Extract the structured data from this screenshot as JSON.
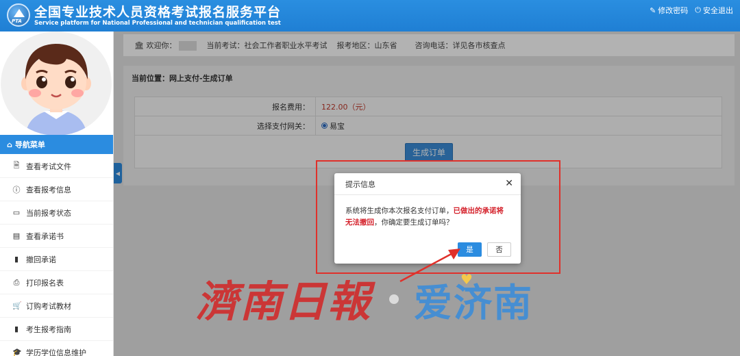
{
  "header": {
    "title_cn": "全国专业技术人员资格考试报名服务平台",
    "title_en": "Service platform for National Professional and technician qualification test",
    "logo_text": "PTA",
    "links": [
      {
        "icon": "edit-icon",
        "label": "修改密码"
      },
      {
        "icon": "power-icon",
        "label": "安全退出"
      }
    ]
  },
  "sidebar": {
    "nav_title": "导航菜单",
    "items": [
      {
        "icon": "document-icon",
        "label": "查看考试文件"
      },
      {
        "icon": "info-icon",
        "label": "查看报考信息"
      },
      {
        "icon": "monitor-icon",
        "label": "当前报考状态"
      },
      {
        "icon": "id-card-icon",
        "label": "查看承诺书"
      },
      {
        "icon": "book-icon",
        "label": "撤回承诺"
      },
      {
        "icon": "printer-icon",
        "label": "打印报名表"
      },
      {
        "icon": "cart-icon",
        "label": "订购考试教材"
      },
      {
        "icon": "book-icon",
        "label": "考生报考指南"
      },
      {
        "icon": "graduation-cap-icon",
        "label": "学历学位信息维护"
      }
    ]
  },
  "infobar": {
    "welcome": "欢迎你：",
    "exam": "当前考试：社会工作者职业水平考试",
    "region": "报考地区：山东省",
    "phone": "咨询电话：详见各市核查点"
  },
  "main": {
    "breadcrumb": "当前位置：网上支付-生成订单",
    "fee_label": "报名费用：",
    "fee_value": "122.00（元）",
    "gateway_label": "选择支付网关：",
    "gateway_option": "易宝",
    "generate_button": "生成订单"
  },
  "dialog": {
    "title": "提示信息",
    "message_part1": "系统将生成你本次报名支付订单，",
    "message_warn": "已做出的承诺将无法撤回",
    "message_part2": "，你确定要生成订单吗？",
    "yes_label": "是",
    "no_label": "否"
  },
  "watermark": {
    "left": "濟南日報",
    "right": "爱济南"
  },
  "colors": {
    "header_blue": "#2a8ee0",
    "highlight_red": "#e0302a",
    "warn_red": "#d4202a",
    "primary_button": "#2b8ce0"
  }
}
